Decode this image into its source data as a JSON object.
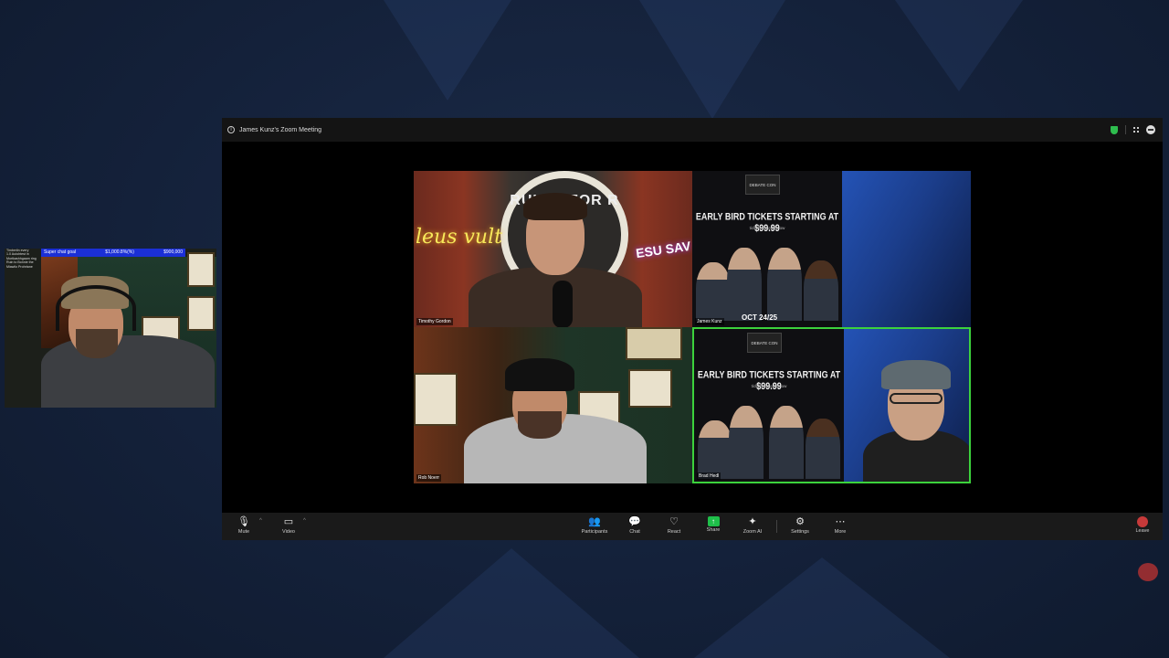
{
  "overlay": {
    "ticker_left": "Super chat goal",
    "ticker_mid": "$1,000.8%(%)",
    "ticker_right": "$900,000",
    "notes": [
      "Timberlin every",
      "1.0 Autohtest in",
      "Mortkashhgaam ring",
      "Ruin to Bonnie the",
      "Miawilo Prohrtane"
    ]
  },
  "zoom": {
    "title": "James Kunz's Zoom Meeting",
    "participants": [
      {
        "name": "Timothy Gordon"
      },
      {
        "name": "James Kunz"
      },
      {
        "name": "Rob Noerr"
      },
      {
        "name": "Brad Hedl"
      }
    ],
    "tile1": {
      "neon_left": "leus vult",
      "neon_right": "ESU SAV",
      "logo": "RULES FOR R"
    },
    "ad": {
      "logo": "DEBATE CON",
      "headline": "EARLY BIRD TICKETS STARTING AT $99.99",
      "sub": "tickets linked below",
      "date": "OCT 24/25"
    },
    "toolbar": {
      "mute": "Mute",
      "video": "Video",
      "participants": "Participants",
      "chat": "Chat",
      "react": "React",
      "share": "Share",
      "zoom_ai": "Zoom AI",
      "settings": "Settings",
      "more": "More",
      "leave": "Leave"
    }
  },
  "colors": {
    "active_speaker": "#3cd23c",
    "share": "#1fbf4a",
    "ticker": "#1b2fd6"
  }
}
